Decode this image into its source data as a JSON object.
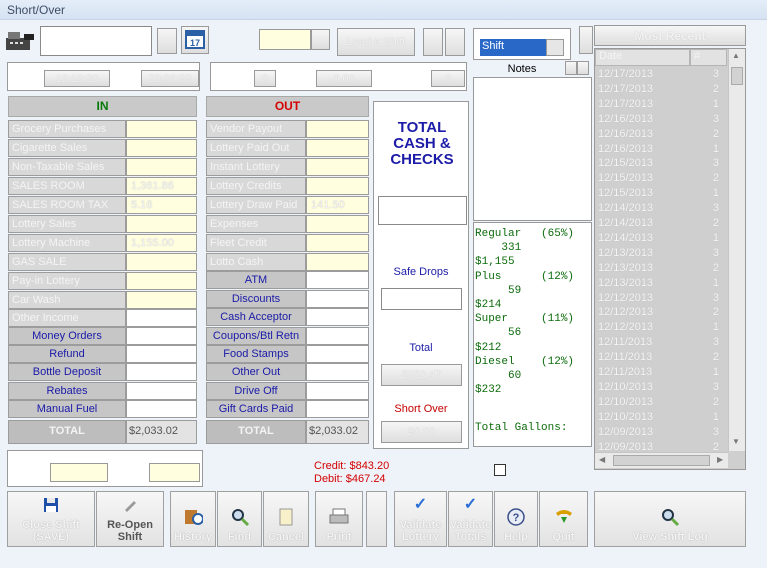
{
  "window": {
    "title": "Short/Over"
  },
  "top": {
    "shift_value": "Shift",
    "load_button": "Load a Shift",
    "notes_label": "Notes",
    "time_start": "18:10:30",
    "time_end": "23:06:59",
    "count_a": "0",
    "amount": "0.00",
    "count_b": "0"
  },
  "most_recent": {
    "title": "Most Recent",
    "col_date": "Date",
    "col_shift": "#",
    "rows": [
      {
        "date": "12/17/2013",
        "shift": "3"
      },
      {
        "date": "12/17/2013",
        "shift": "2"
      },
      {
        "date": "12/17/2013",
        "shift": "1"
      },
      {
        "date": "12/16/2013",
        "shift": "3"
      },
      {
        "date": "12/16/2013",
        "shift": "2"
      },
      {
        "date": "12/16/2013",
        "shift": "1"
      },
      {
        "date": "12/15/2013",
        "shift": "3"
      },
      {
        "date": "12/15/2013",
        "shift": "2"
      },
      {
        "date": "12/15/2013",
        "shift": "1"
      },
      {
        "date": "12/14/2013",
        "shift": "3"
      },
      {
        "date": "12/14/2013",
        "shift": "2"
      },
      {
        "date": "12/14/2013",
        "shift": "1"
      },
      {
        "date": "12/13/2013",
        "shift": "3"
      },
      {
        "date": "12/13/2013",
        "shift": "2"
      },
      {
        "date": "12/13/2013",
        "shift": "1"
      },
      {
        "date": "12/12/2013",
        "shift": "3"
      },
      {
        "date": "12/12/2013",
        "shift": "2"
      },
      {
        "date": "12/12/2013",
        "shift": "1"
      },
      {
        "date": "12/11/2013",
        "shift": "3"
      },
      {
        "date": "12/11/2013",
        "shift": "2"
      },
      {
        "date": "12/11/2013",
        "shift": "1"
      },
      {
        "date": "12/10/2013",
        "shift": "3"
      },
      {
        "date": "12/10/2013",
        "shift": "2"
      },
      {
        "date": "12/10/2013",
        "shift": "1"
      },
      {
        "date": "12/09/2013",
        "shift": "3"
      },
      {
        "date": "12/09/2013",
        "shift": "2"
      }
    ]
  },
  "in": {
    "header": "IN",
    "rows": [
      {
        "label": "Grocery Purchases",
        "value": ""
      },
      {
        "label": "Cigarette Sales",
        "value": ""
      },
      {
        "label": "Non-Taxable Sales",
        "value": ""
      },
      {
        "label": "SALES ROOM",
        "value": "1,361.86"
      },
      {
        "label": "SALES ROOM TAX",
        "value": "5.16"
      },
      {
        "label": "Lottery Sales",
        "value": ""
      },
      {
        "label": "Lottery Machine",
        "value": "1,155.00"
      },
      {
        "label": "GAS SALE",
        "value": ""
      },
      {
        "label": "Pay-in Lottery",
        "value": ""
      },
      {
        "label": "Car Wash",
        "value": ""
      },
      {
        "label": "Other Income",
        "value": ""
      }
    ],
    "money_orders": "Money Orders",
    "refund": "Refund",
    "bottle_deposit": "Bottle Deposit",
    "rebates": "Rebates",
    "manual_fuel": "Manual Fuel",
    "total_label": "TOTAL",
    "total_value": "$2,033.02"
  },
  "out": {
    "header": "OUT",
    "rows": [
      {
        "label": "Vendor Payout",
        "value": ""
      },
      {
        "label": "Lottery Paid Out",
        "value": ""
      },
      {
        "label": "Instant Lottery",
        "value": ""
      },
      {
        "label": "Lottery Credits",
        "value": ""
      },
      {
        "label": "Lottery Draw Paid",
        "value": "141.50"
      },
      {
        "label": "Expenses",
        "value": ""
      },
      {
        "label": "Fleet Credit",
        "value": ""
      },
      {
        "label": "Lotto Cash",
        "value": ""
      }
    ],
    "atm": "ATM",
    "discounts": "Discounts",
    "cash_acceptor": "Cash Acceptor",
    "coupons": "Coupons/Btl Retn",
    "food_stamps": "Food Stamps",
    "other_out": "Other Out",
    "drive_off": "Drive Off",
    "gift_cards_paid": "Gift Cards Paid",
    "total_label": "TOTAL",
    "total_value": "$2,033.02"
  },
  "center": {
    "total_cash_checks": "TOTAL CASH & CHECKS",
    "safe_drops": "Safe Drops",
    "total_label": "Total",
    "total_value": "$550.47",
    "short_over_label": "Short Over",
    "short_over_value": "$0.00"
  },
  "fuel": {
    "regular_line": "Regular   (65%)",
    "regular_gal": "    331",
    "regular_amt": "$1,155",
    "plus_line": "Plus      (12%)",
    "plus_gal": "     59",
    "plus_amt": "$214",
    "super_line": "Super     (11%)",
    "super_gal": "     56",
    "super_amt": "$212",
    "diesel_line": "Diesel    (12%)",
    "diesel_gal": "     60",
    "diesel_amt": "$232",
    "total_label": "Total Gallons:"
  },
  "footer": {
    "credit": "Credit: $843.20",
    "debit": "Debit: $467.24"
  },
  "buttons": {
    "close_shift": "Close Shift\n(SAVE)",
    "reopen_shift": "Re-Open\nShift",
    "history": "History",
    "find": "Find",
    "cancel": "Cancel",
    "print": "Print",
    "validate_lottery": "Validate\nLottery",
    "validate_totals": "Validate\nTotals",
    "help": "Help",
    "quit": "Quit",
    "view_shift_log": "View Shift Log"
  }
}
